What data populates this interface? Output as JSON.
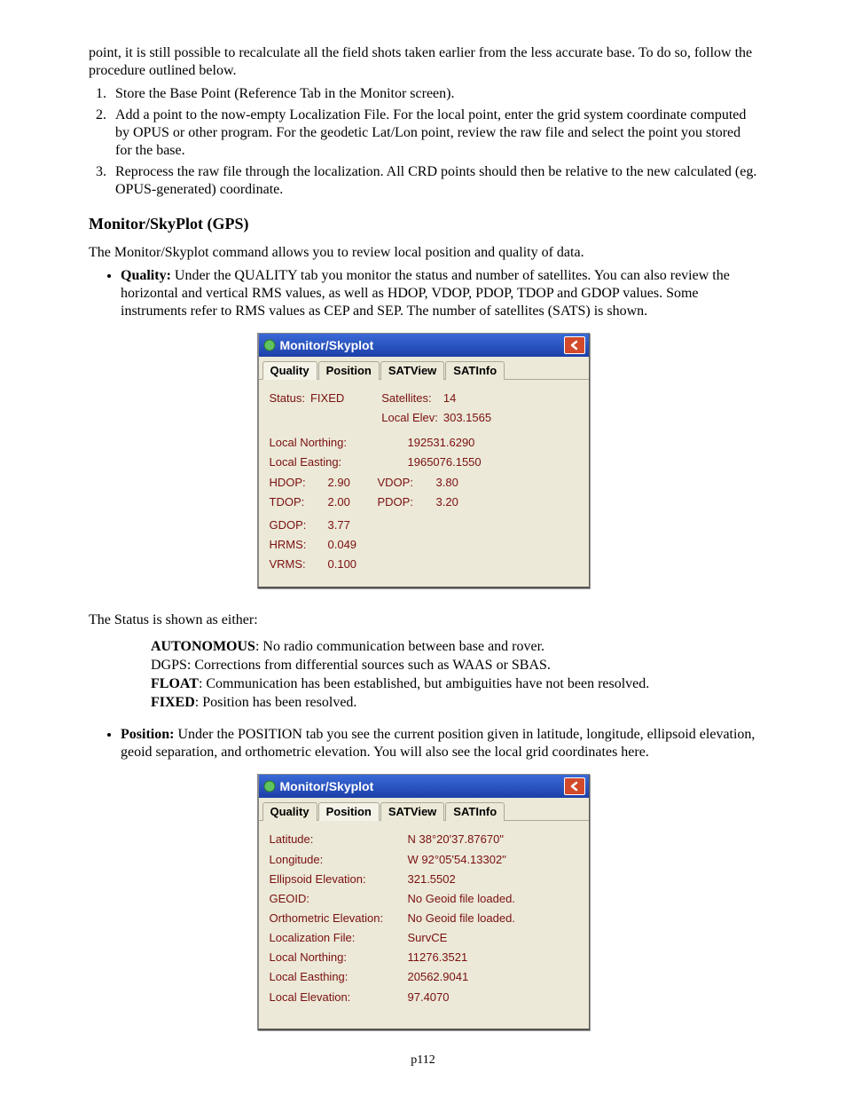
{
  "intro": {
    "p1": "point, it is still possible to recalculate all the field shots taken earlier from the less accurate base.  To do so, follow the procedure outlined below.",
    "li1": "Store the Base Point (Reference Tab in the Monitor screen).",
    "li2": "Add a point to the now-empty Localization File.  For the local point, enter the grid system coordinate computed by OPUS or other program.  For the geodetic Lat/Lon point, review the raw file and select the point you stored for the base.",
    "li3": "Reprocess the raw file through the localization.  All CRD points should then be relative to the new calculated (eg. OPUS-generated) coordinate."
  },
  "heading": "Monitor/SkyPlot (GPS)",
  "lead": "The Monitor/Skyplot command allows you to review local position and quality of data.",
  "quality_bullet": {
    "label": "Quality:",
    "text": " Under the QUALITY tab you monitor the status and number of satellites.  You can also review the horizontal and vertical RMS values, as well as HDOP, VDOP, PDOP, TDOP and GDOP values. Some instruments refer to RMS values as CEP and SEP. The number of satellites (SATS) is shown."
  },
  "win": {
    "title": "Monitor/Skyplot"
  },
  "tabs": {
    "quality": "Quality",
    "position": "Position",
    "satview": "SATView",
    "satinfo": "SATInfo"
  },
  "q": {
    "status_l": "Status:",
    "status_v": "FIXED",
    "sat_l": "Satellites:",
    "sat_v": "14",
    "elev_l": "Local Elev:",
    "elev_v": "303.1565",
    "ln_l": "Local Northing:",
    "ln_v": "192531.6290",
    "le_l": "Local Easting:",
    "le_v": "1965076.1550",
    "hdop_l": "HDOP:",
    "hdop_v": "2.90",
    "vdop_l": "VDOP:",
    "vdop_v": "3.80",
    "tdop_l": "TDOP:",
    "tdop_v": "2.00",
    "pdop_l": "PDOP:",
    "pdop_v": "3.20",
    "gdop_l": "GDOP:",
    "gdop_v": "3.77",
    "hrms_l": "HRMS:",
    "hrms_v": "0.049",
    "vrms_l": "VRMS:",
    "vrms_v": "0.100"
  },
  "status_intro": "The Status is shown as either:",
  "statuses": {
    "a_l": "AUTONOMOUS",
    "a_t": ": No radio communication between base and rover.",
    "b_l": "DGPS:",
    "b_t": " Corrections from differential sources such as WAAS or SBAS.",
    "c_l": "FLOAT",
    "c_t": ": Communication has been established, but ambiguities have not been resolved.",
    "d_l": "FIXED",
    "d_t": ": Position has been resolved."
  },
  "position_bullet": {
    "label": "Position:",
    "text": " Under the POSITION tab you see the current position given in latitude, longitude, ellipsoid elevation, geoid separation, and orthometric elevation. You will also see the local grid coordinates here."
  },
  "p": {
    "lat_l": "Latitude:",
    "lat_v": "N 38°20'37.87670\"",
    "lon_l": "Longitude:",
    "lon_v": "W 92°05'54.13302\"",
    "ee_l": "Ellipsoid Elevation:",
    "ee_v": "321.5502",
    "geoid_l": "GEOID:",
    "geoid_v": "No Geoid file loaded.",
    "oe_l": "Orthometric Elevation:",
    "oe_v": "No Geoid file loaded.",
    "lf_l": "Localization File:",
    "lf_v": "SurvCE",
    "ln_l": "Local Northing:",
    "ln_v": "11276.3521",
    "le_l": "Local Easthing:",
    "le_v": "20562.9041",
    "lev_l": "Local Elevation:",
    "lev_v": "97.4070"
  },
  "footer": "p112"
}
